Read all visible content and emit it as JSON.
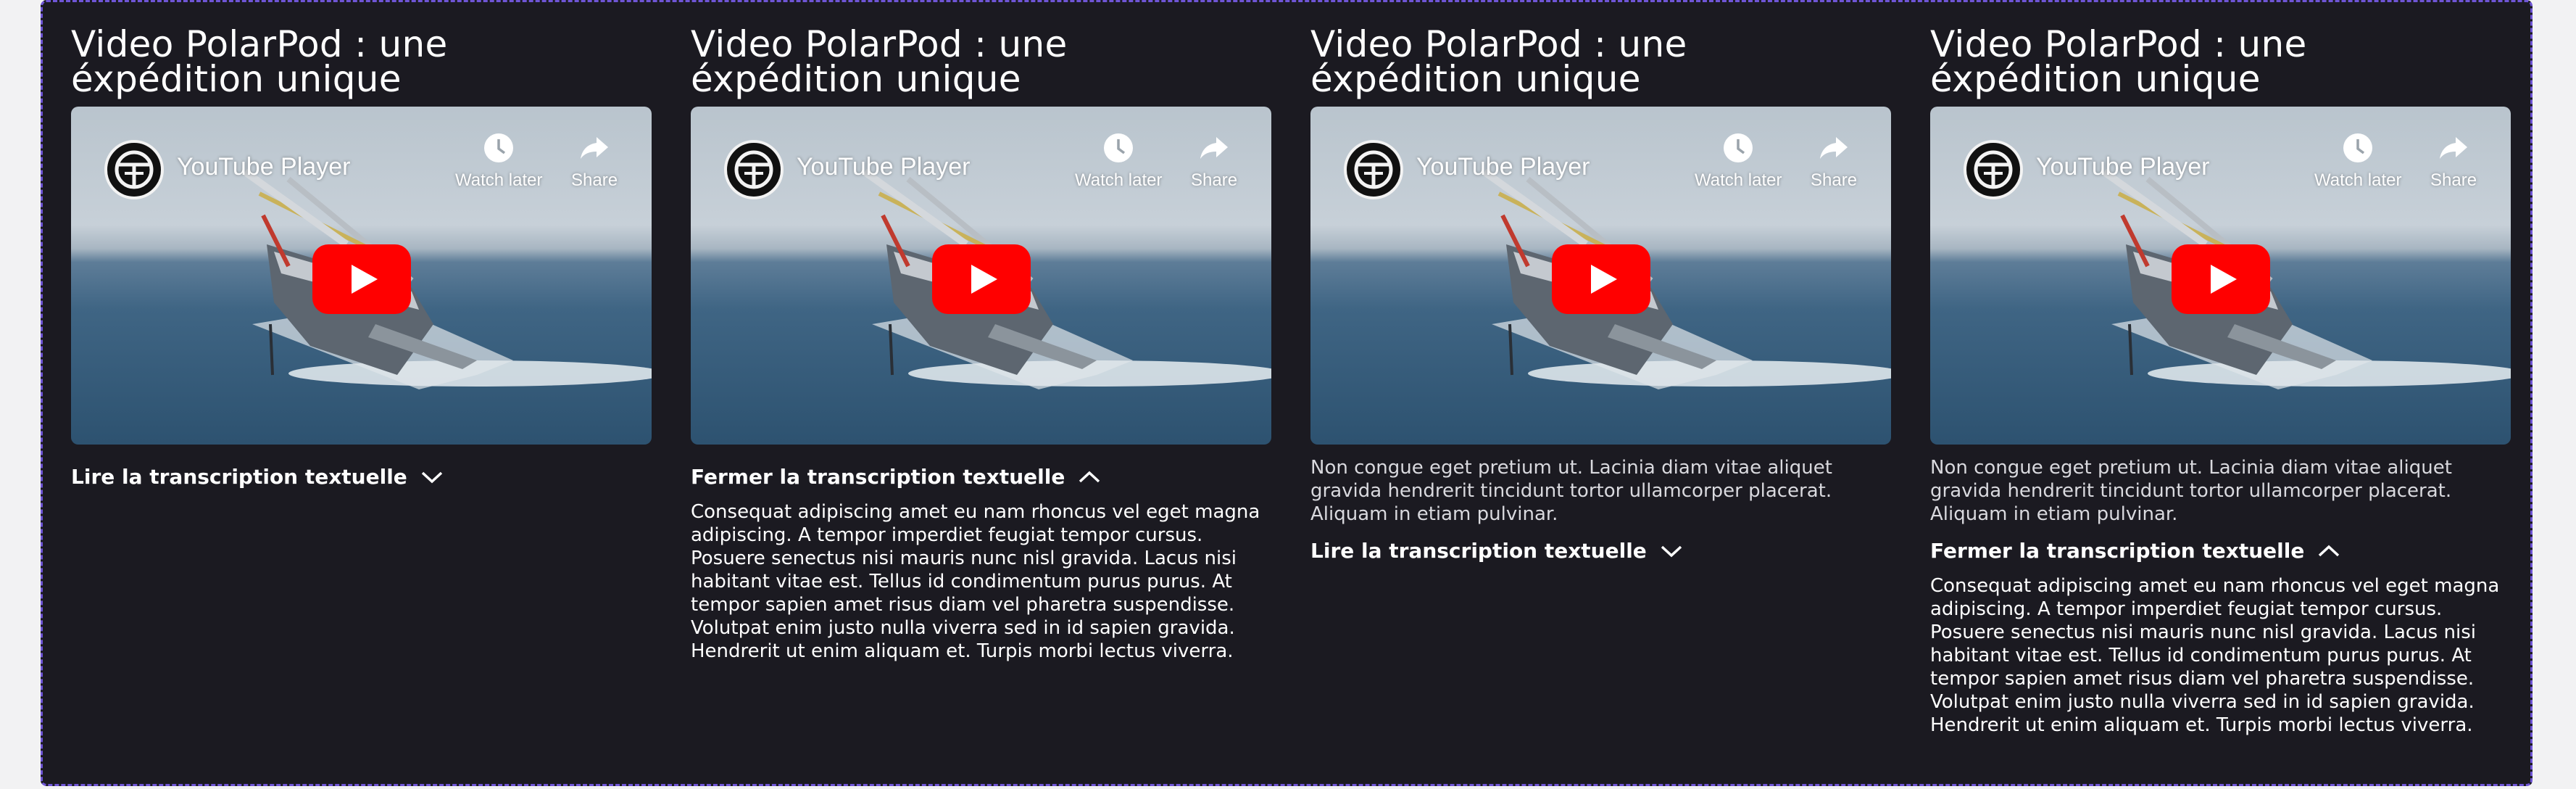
{
  "cards": [
    {
      "title": "Video PolarPod : une éxpédition unique",
      "player": {
        "name": "YouTube Player",
        "watch_later": "Watch later",
        "share": "Share"
      },
      "toggle_label": "Lire la transcription textuelle",
      "expanded": false
    },
    {
      "title": "Video PolarPod : une éxpédition unique",
      "player": {
        "name": "YouTube Player",
        "watch_later": "Watch later",
        "share": "Share"
      },
      "toggle_label": "Fermer la transcription textuelle",
      "expanded": true,
      "transcript": "Consequat adipiscing amet eu nam rhoncus vel eget magna adipiscing. A tempor imperdiet feugiat tempor cursus. Posuere senectus nisi mauris nunc nisl gravida. Lacus nisi habitant vitae est. Tellus id condimentum purus purus. At tempor sapien amet risus diam vel pharetra suspendisse. Volutpat enim justo nulla viverra sed in id sapien gravida. Hendrerit ut enim aliquam et. Turpis morbi lectus viverra."
    },
    {
      "title": "Video PolarPod : une éxpédition unique",
      "player": {
        "name": "YouTube Player",
        "watch_later": "Watch later",
        "share": "Share"
      },
      "summary": "Non congue eget pretium ut. Lacinia diam vitae aliquet gravida hendrerit tincidunt tortor ullamcorper placerat. Aliquam in etiam pulvinar.",
      "toggle_label": "Lire la transcription textuelle",
      "expanded": false
    },
    {
      "title": "Video PolarPod : une éxpédition unique",
      "player": {
        "name": "YouTube Player",
        "watch_later": "Watch later",
        "share": "Share"
      },
      "summary": "Non congue eget pretium ut. Lacinia diam vitae aliquet gravida hendrerit tincidunt tortor ullamcorper placerat. Aliquam in etiam pulvinar.",
      "toggle_label": "Fermer la transcription textuelle",
      "expanded": true,
      "transcript": "Consequat adipiscing amet eu nam rhoncus vel eget magna adipiscing. A tempor imperdiet feugiat tempor cursus. Posuere senectus nisi mauris nunc nisl gravida. Lacus nisi habitant vitae est. Tellus id condimentum purus purus. At tempor sapien amet risus diam vel pharetra suspendisse. Volutpat enim justo nulla viverra sed in id sapien gravida. Hendrerit ut enim aliquam et. Turpis morbi lectus viverra."
    }
  ],
  "icons": {
    "channel": "polarpod-logo-icon",
    "watch_later": "clock-icon",
    "share": "share-arrow-icon",
    "play": "youtube-play-icon",
    "expand": "chevron-down-icon",
    "collapse": "chevron-up-icon"
  },
  "colors": {
    "background": "#1b1a21",
    "frame_border": "#6f55d6",
    "youtube_red": "#ff0000",
    "text": "#ffffff"
  }
}
